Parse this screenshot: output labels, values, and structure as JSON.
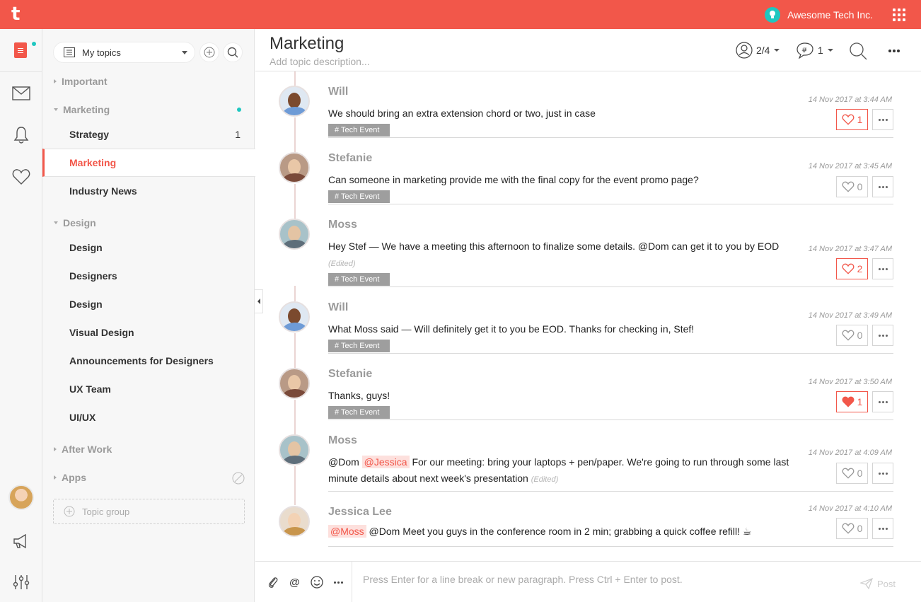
{
  "org": {
    "name": "Awesome Tech Inc."
  },
  "sidebar": {
    "filter_label": "My topics",
    "groups": {
      "important": "Important",
      "marketing": "Marketing",
      "design": "Design",
      "after_work": "After Work",
      "apps": "Apps"
    },
    "items": {
      "strategy": {
        "label": "Strategy",
        "count": "1"
      },
      "marketing": {
        "label": "Marketing"
      },
      "industry_news": {
        "label": "Industry News"
      },
      "design1": {
        "label": "Design"
      },
      "designers": {
        "label": "Designers"
      },
      "design2": {
        "label": "Design"
      },
      "visual_design": {
        "label": "Visual Design"
      },
      "announcements": {
        "label": "Announcements for Designers"
      },
      "ux_team": {
        "label": "UX Team"
      },
      "ui_ux": {
        "label": "UI/UX"
      }
    },
    "topic_group_label": "Topic group"
  },
  "header": {
    "title": "Marketing",
    "description_placeholder": "Add topic description...",
    "members": "2/4",
    "threads": "1"
  },
  "messages": [
    {
      "author": "Will",
      "text": "We should bring an extra extension chord or two, just in case",
      "tag": "# Tech Event",
      "time": "14 Nov 2017 at 3:44 AM",
      "likes": "1"
    },
    {
      "author": "Stefanie",
      "text": "Can someone in marketing provide me with the final copy for the event promo page?",
      "tag": "# Tech Event",
      "time": "14 Nov 2017 at 3:45 AM",
      "likes": "0"
    },
    {
      "author": "Moss",
      "text": "Hey Stef — We have a meeting this afternoon to finalize some details. @Dom can get it to you by EOD",
      "edited": "(Edited)",
      "tag": "# Tech Event",
      "time": "14 Nov 2017 at 3:47 AM",
      "likes": "2"
    },
    {
      "author": "Will",
      "text": "What Moss said — Will definitely get it to you be EOD. Thanks for checking in, Stef!",
      "tag": "# Tech Event",
      "time": "14 Nov 2017 at 3:49 AM",
      "likes": "0"
    },
    {
      "author": "Stefanie",
      "text": "Thanks, guys!",
      "tag": "# Tech Event",
      "time": "14 Nov 2017 at 3:50 AM",
      "likes": "1"
    },
    {
      "author": "Moss",
      "text_pre": "@Dom ",
      "mention": "@Jessica",
      "text_post": " For our meeting: bring your laptops + pen/paper. We're going to run through some last minute details about next week's presentation",
      "edited": "(Edited)",
      "time": "14 Nov 2017 at 4:09 AM",
      "likes": "0"
    },
    {
      "author": "Jessica Lee",
      "mention": "@Moss",
      "text_post": " @Dom Meet you guys in the conference room in 2 min; grabbing a quick coffee refill! ☕",
      "time": "14 Nov 2017 at 4:10 AM",
      "likes": "0"
    }
  ],
  "composer": {
    "placeholder": "Press Enter for a line break or new paragraph. Press Ctrl + Enter to post.",
    "post_label": "Post"
  },
  "colors": {
    "brand": "#f2574a",
    "accent": "#1fc7c0"
  }
}
